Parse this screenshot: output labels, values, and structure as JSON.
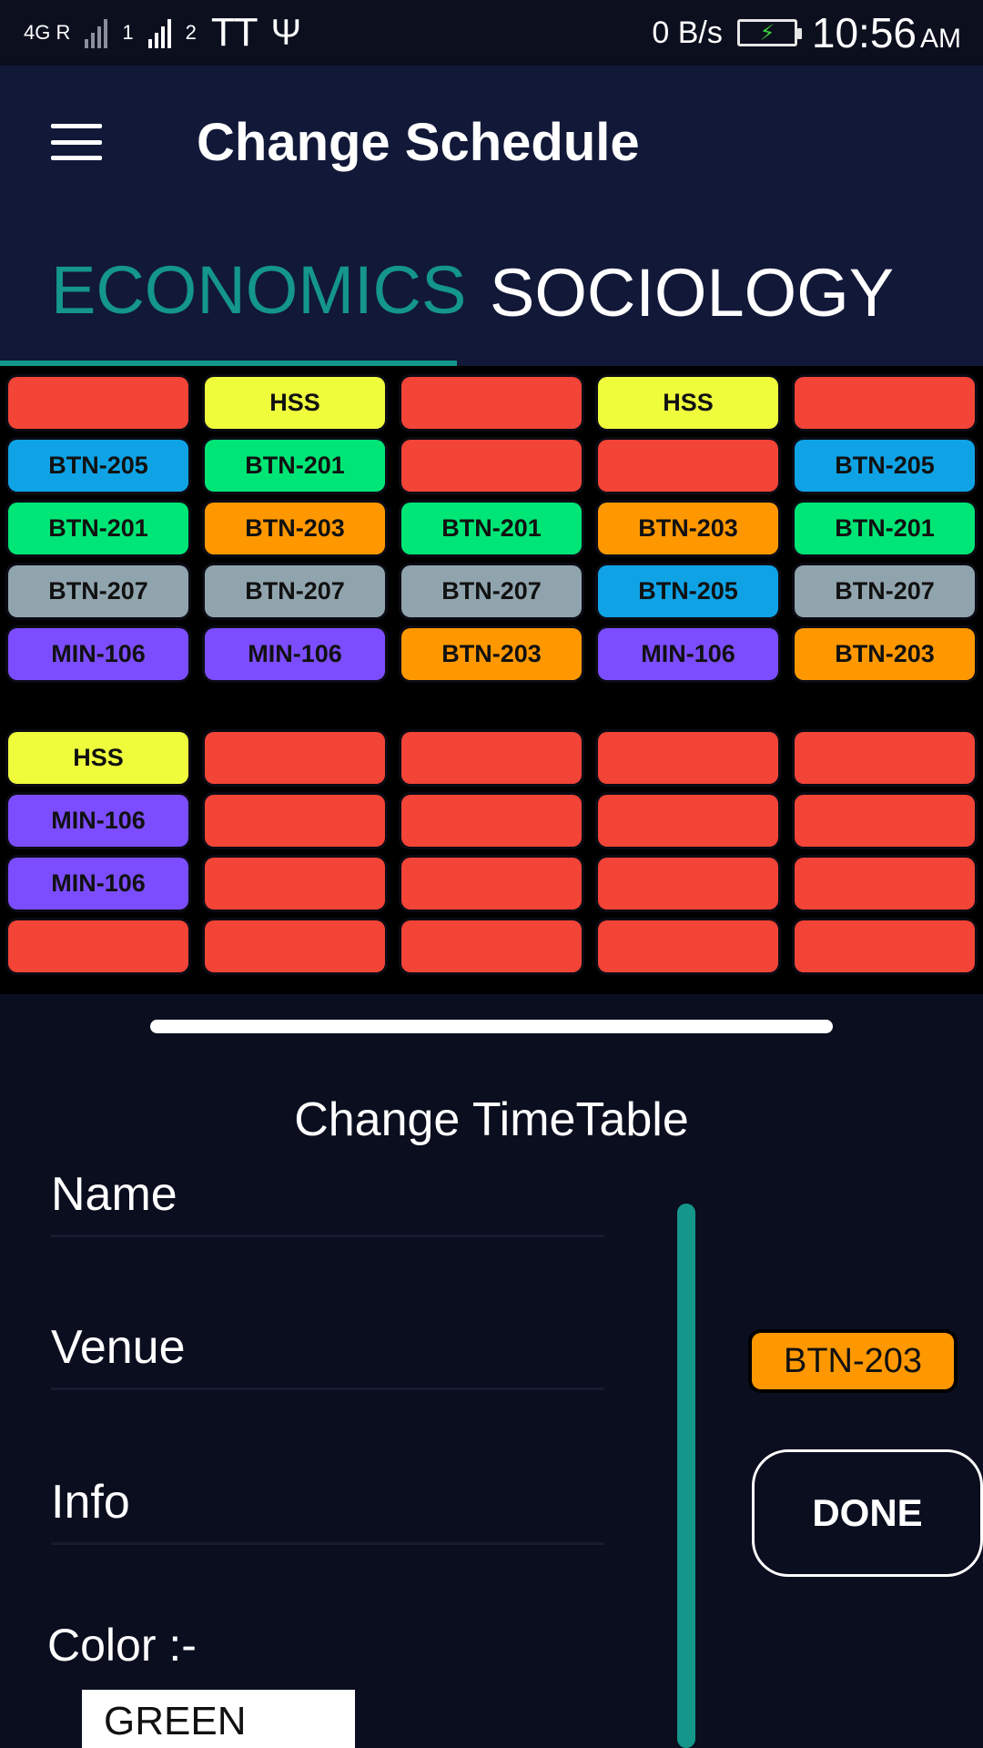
{
  "status_bar": {
    "network": "4G R",
    "sim1": "1",
    "sim2": "2",
    "tt": "TT",
    "net_speed": "0 B/s",
    "time": "10:56",
    "ampm": "AM"
  },
  "app_bar": {
    "title": "Change Schedule"
  },
  "tabs": [
    {
      "label": "ECONOMICS",
      "active": true
    },
    {
      "label": "SOCIOLOGY",
      "active": false
    }
  ],
  "colors": {
    "red": "#f24437",
    "yellow": "#eefc3c",
    "blue": "#0fa3e6",
    "green": "#00e676",
    "orange": "#ff9800",
    "grey": "#90a4ae",
    "purple": "#7c4dff",
    "accent": "#14968a"
  },
  "grid_top": [
    [
      {
        "t": "",
        "c": "red"
      },
      {
        "t": "HSS",
        "c": "yellow"
      },
      {
        "t": "",
        "c": "red"
      },
      {
        "t": "HSS",
        "c": "yellow"
      },
      {
        "t": "",
        "c": "red"
      }
    ],
    [
      {
        "t": "BTN-205",
        "c": "blue"
      },
      {
        "t": "BTN-201",
        "c": "green"
      },
      {
        "t": "",
        "c": "red"
      },
      {
        "t": "",
        "c": "red"
      },
      {
        "t": "BTN-205",
        "c": "blue"
      }
    ],
    [
      {
        "t": "BTN-201",
        "c": "green"
      },
      {
        "t": "BTN-203",
        "c": "orange"
      },
      {
        "t": "BTN-201",
        "c": "green"
      },
      {
        "t": "BTN-203",
        "c": "orange"
      },
      {
        "t": "BTN-201",
        "c": "green"
      }
    ],
    [
      {
        "t": "BTN-207",
        "c": "grey"
      },
      {
        "t": "BTN-207",
        "c": "grey"
      },
      {
        "t": "BTN-207",
        "c": "grey"
      },
      {
        "t": "BTN-205",
        "c": "blue"
      },
      {
        "t": "BTN-207",
        "c": "grey"
      }
    ],
    [
      {
        "t": "MIN-106",
        "c": "purple"
      },
      {
        "t": "MIN-106",
        "c": "purple"
      },
      {
        "t": "BTN-203",
        "c": "orange"
      },
      {
        "t": "MIN-106",
        "c": "purple"
      },
      {
        "t": "BTN-203",
        "c": "orange"
      }
    ]
  ],
  "grid_bottom": [
    [
      {
        "t": "HSS",
        "c": "yellow"
      },
      {
        "t": "",
        "c": "red"
      },
      {
        "t": "",
        "c": "red"
      },
      {
        "t": "",
        "c": "red"
      },
      {
        "t": "",
        "c": "red"
      }
    ],
    [
      {
        "t": "MIN-106",
        "c": "purple"
      },
      {
        "t": "",
        "c": "red"
      },
      {
        "t": "",
        "c": "red"
      },
      {
        "t": "",
        "c": "red"
      },
      {
        "t": "",
        "c": "red"
      }
    ],
    [
      {
        "t": "MIN-106",
        "c": "purple"
      },
      {
        "t": "",
        "c": "red"
      },
      {
        "t": "",
        "c": "red"
      },
      {
        "t": "",
        "c": "red"
      },
      {
        "t": "",
        "c": "red"
      }
    ],
    [
      {
        "t": "",
        "c": "red"
      },
      {
        "t": "",
        "c": "red"
      },
      {
        "t": "",
        "c": "red"
      },
      {
        "t": "",
        "c": "red"
      },
      {
        "t": "",
        "c": "red"
      }
    ]
  ],
  "form": {
    "title": "Change TimeTable",
    "name_label": "Name",
    "venue_label": "Venue",
    "info_label": "Info",
    "color_label": "Color :-",
    "color_value": "GREEN",
    "selected_chip": "BTN-203",
    "done_label": "DONE"
  }
}
